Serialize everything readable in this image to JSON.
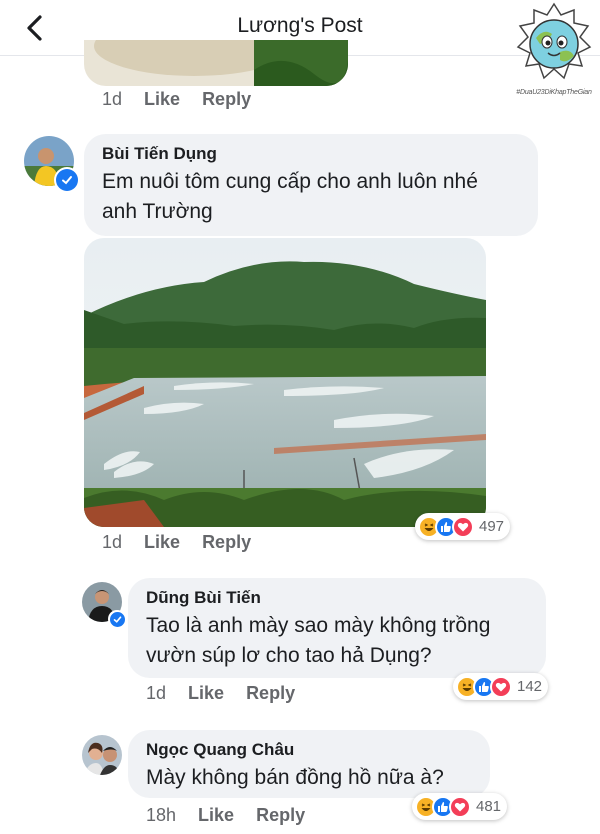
{
  "header": {
    "title": "Lương's Post"
  },
  "logo": {
    "hashtag": "#DuaU23DiKhapTheGian"
  },
  "colors": {
    "accent": "#1877f2",
    "bubble": "#f0f2f5",
    "meta": "#65676b",
    "love": "#f33e58",
    "haha": "#f7b125"
  },
  "prev_comment": {
    "time": "1d",
    "like": "Like",
    "reply": "Reply"
  },
  "comments": [
    {
      "name": "Bùi Tiến Dụng",
      "text_line1": "Em nuôi tôm cung cấp cho anh luôn nhé",
      "text_line2": "anh Trường",
      "time": "1d",
      "like": "Like",
      "reply": "Reply",
      "reaction_icons": [
        "haha-icon",
        "like-icon",
        "love-icon"
      ],
      "reaction_count": "497",
      "verified": true
    },
    {
      "name": "Dũng Bùi Tiến",
      "text_line1": "Tao là anh mày sao mày không trồng",
      "text_line2": "vườn súp lơ cho tao hả Dụng?",
      "time": "1d",
      "like": "Like",
      "reply": "Reply",
      "reaction_icons": [
        "haha-icon",
        "like-icon",
        "love-icon"
      ],
      "reaction_count": "142",
      "verified": true
    },
    {
      "name": "Ngọc Quang Châu",
      "text_line1": "Mày không bán đồng hồ nữa à?",
      "time": "18h",
      "like": "Like",
      "reply": "Reply",
      "reaction_icons": [
        "haha-icon",
        "like-icon",
        "love-icon"
      ],
      "reaction_count": "481",
      "verified": false
    }
  ]
}
